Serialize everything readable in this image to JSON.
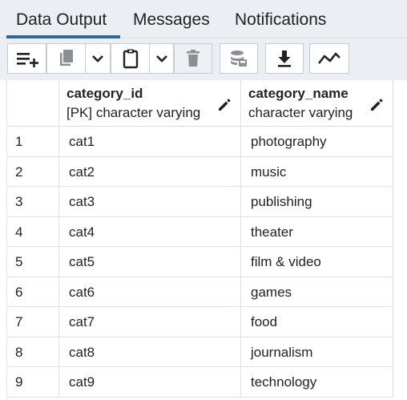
{
  "tabs": [
    {
      "label": "Data Output",
      "active": true
    },
    {
      "label": "Messages",
      "active": false
    },
    {
      "label": "Notifications",
      "active": false
    }
  ],
  "toolbar": {
    "icons": [
      "add-row-icon",
      "copy-icon",
      "chevron-down-icon",
      "paste-icon",
      "chevron-down-icon",
      "delete-icon",
      "save-data-icon",
      "download-icon",
      "graph-icon"
    ]
  },
  "grid": {
    "columns": [
      {
        "name": "category_id",
        "type": "[PK] character varying"
      },
      {
        "name": "category_name",
        "type": "character varying"
      }
    ],
    "rows": [
      {
        "num": "1",
        "id": "cat1",
        "name": "photography"
      },
      {
        "num": "2",
        "id": "cat2",
        "name": "music"
      },
      {
        "num": "3",
        "id": "cat3",
        "name": "publishing"
      },
      {
        "num": "4",
        "id": "cat4",
        "name": "theater"
      },
      {
        "num": "5",
        "id": "cat5",
        "name": "film & video"
      },
      {
        "num": "6",
        "id": "cat6",
        "name": "games"
      },
      {
        "num": "7",
        "id": "cat7",
        "name": "food"
      },
      {
        "num": "8",
        "id": "cat8",
        "name": "journalism"
      },
      {
        "num": "9",
        "id": "cat9",
        "name": "technology"
      }
    ]
  },
  "colors": {
    "accent": "#326690",
    "tab_bg": "#ebeef3",
    "border": "#dde0e6"
  }
}
